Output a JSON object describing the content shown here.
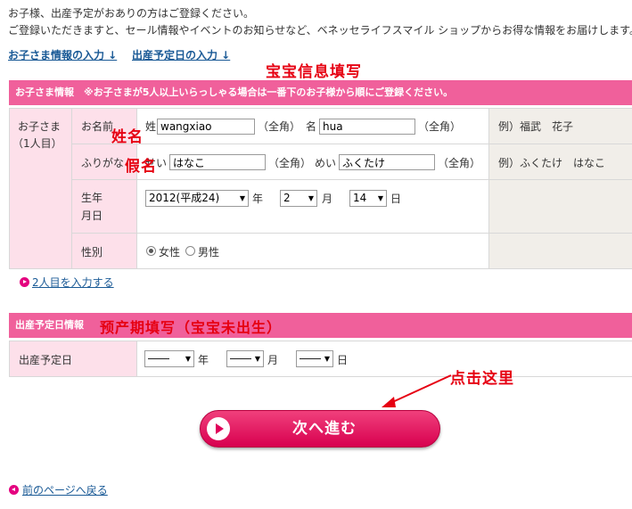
{
  "intro": {
    "line1": "お子様、出産予定がおありの方はご登録ください。",
    "line2": "ご登録いただきますと、セール情報やイベントのお知らせなど、ベネッセライフスマイル ショップからお得な情報をお届けします。"
  },
  "anchors": {
    "child_info": "お子さま情報の入力 ↓",
    "due_date": "出産予定日の入力 ↓"
  },
  "annotations": {
    "baby_info": "宝宝信息填写",
    "name": "姓名",
    "kana": "假名",
    "due_date": "预产期填写（宝宝未出生）",
    "click_here": "点击这里"
  },
  "child_section": {
    "header": "お子さま情報　※お子さまが5人以上いらっしゃる場合は一番下のお子様から順にご登録ください。",
    "child_label": "お子さま",
    "child_index": "（1人目）",
    "name": {
      "label": "お名前",
      "sei_label": "姓",
      "sei_value": "wangxiao",
      "mei_label": "名",
      "mei_value": "hua",
      "zenkaku": "（全角）",
      "example": "例）福武　花子"
    },
    "kana": {
      "label": "ふりがな",
      "sei_label": "せい",
      "sei_value": "はなこ",
      "mei_label": "めい",
      "mei_value": "ふくたけ",
      "zenkaku": "（全角）",
      "example": "例）ふくたけ　はなこ"
    },
    "birthday": {
      "label_line1": "生年",
      "label_line2": "月日",
      "year": "2012(平成24)",
      "year_unit": "年",
      "month": "2",
      "month_unit": "月",
      "day": "14",
      "day_unit": "日"
    },
    "gender": {
      "label": "性別",
      "female": "女性",
      "male": "男性",
      "selected": "female"
    },
    "add_second": "2人目を入力する"
  },
  "due_section": {
    "header": "出産予定日情報",
    "label": "出産予定日",
    "year": "――",
    "year_unit": "年",
    "month": "――",
    "month_unit": "月",
    "day": "――",
    "day_unit": "日"
  },
  "buttons": {
    "next": "次へ進む",
    "back": "前のページへ戻る"
  },
  "colors": {
    "header_pink": "#f0609b",
    "label_pink": "#fde0ea",
    "example_gray": "#f1eee9",
    "button_magenta": "#e0005a",
    "annotation_red": "#e60012",
    "link_blue": "#1a5a96"
  }
}
